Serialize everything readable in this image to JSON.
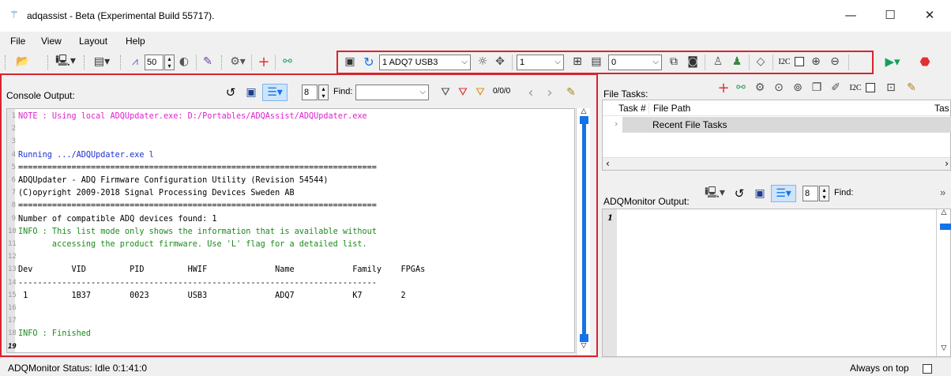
{
  "window": {
    "title": "adqassist - Beta (Experimental Build 55717).",
    "logo_icon": "adq-logo-icon",
    "minimize": "—",
    "maximize": "☐",
    "close": "✕"
  },
  "menu": [
    "File",
    "View",
    "Layout",
    "Help"
  ],
  "toolbar": {
    "zoom_value": "50",
    "device_combo": "1 ADQ7 USB3",
    "channel_combo": "1",
    "value_combo": "0",
    "i2c_label": "I2C"
  },
  "console": {
    "label": "Console Output:",
    "font_size_value": "8",
    "find_label": "Find:",
    "find_value": "",
    "match_counter": "0/0/0",
    "lines": [
      {
        "n": "1",
        "text": "NOTE : Using local ADQUpdater.exe: D:/Portables/ADQAssist/ADQUpdater.exe",
        "color": "#e020d0"
      },
      {
        "n": "2",
        "text": "",
        "color": "#000000"
      },
      {
        "n": "3",
        "text": "",
        "color": "#000000"
      },
      {
        "n": "4",
        "text": "Running .../ADQUpdater.exe l",
        "color": "#1c2fd0"
      },
      {
        "n": "5",
        "text": "==========================================================================",
        "color": "#000000"
      },
      {
        "n": "6",
        "text": "ADQUpdater - ADQ Firmware Configuration Utility (Revision 54544)",
        "color": "#000000"
      },
      {
        "n": "7",
        "text": "(C)opyright 2009-2018 Signal Processing Devices Sweden AB",
        "color": "#000000"
      },
      {
        "n": "8",
        "text": "==========================================================================",
        "color": "#000000"
      },
      {
        "n": "9",
        "text": "Number of compatible ADQ devices found: 1",
        "color": "#000000"
      },
      {
        "n": "10",
        "text": "INFO : This list mode only shows the information that is available without",
        "color": "#1a8a1a"
      },
      {
        "n": "11",
        "text": "       accessing the product firmware. Use 'L' flag for a detailed list.",
        "color": "#1a8a1a"
      },
      {
        "n": "12",
        "text": "",
        "color": "#000000"
      },
      {
        "n": "13",
        "text": "Dev        VID         PID         HWIF              Name            Family    FPGAs",
        "color": "#000000"
      },
      {
        "n": "14",
        "text": "--------------------------------------------------------------------------",
        "color": "#000000"
      },
      {
        "n": "15",
        "text": " 1         1B37        0023        USB3              ADQ7            K7        2",
        "color": "#000000"
      },
      {
        "n": "16",
        "text": "",
        "color": "#000000"
      },
      {
        "n": "17",
        "text": "",
        "color": "#000000"
      },
      {
        "n": "18",
        "text": "INFO : Finished",
        "color": "#1a8a1a"
      },
      {
        "n": "19",
        "text": "",
        "color": "#000000"
      }
    ]
  },
  "file_tasks": {
    "label": "File Tasks:",
    "i2c_label": "I2C",
    "col_task": "Task #",
    "col_path": "File Path",
    "col_trunc": "Tas",
    "group_row": "Recent File Tasks"
  },
  "monitor": {
    "label": "ADQMonitor Output:",
    "font_size_value": "8",
    "find_label": "Find:",
    "overflow": "»",
    "line_number": "1"
  },
  "status": {
    "text": "ADQMonitor Status: Idle 0:1:41:0",
    "always_on_top": "Always on top"
  },
  "colors": {
    "highlight_red": "#d9232e",
    "accent_blue": "#1473e6"
  }
}
